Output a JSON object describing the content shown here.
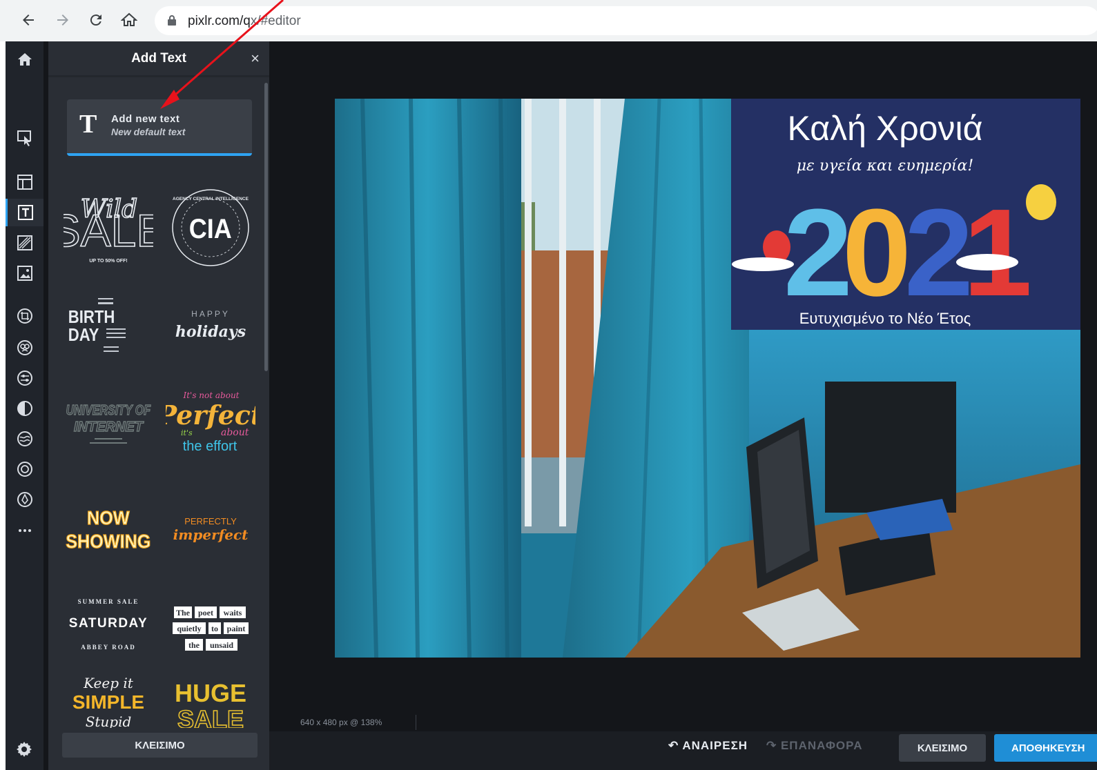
{
  "browser": {
    "url_host": "pixlr.com/",
    "url_path": "x/#editor"
  },
  "panel": {
    "title": "Add Text",
    "close_glyph": "×",
    "add_new_text": "Add new text",
    "add_new_subtext": "New default text",
    "t_glyph": "T",
    "footer_close": "ΚΛΕΙΣΙΜΟ"
  },
  "presets": [
    {
      "name": "wild-sale",
      "lines": [
        "Wild",
        "SALE",
        "UP TO 50% OFF!"
      ]
    },
    {
      "name": "cia",
      "lines": [
        "CIA",
        "AGENCY CENTRAL INTELLIGENCE"
      ]
    },
    {
      "name": "birthday",
      "lines": [
        "BIRTH",
        "DAY"
      ]
    },
    {
      "name": "happy-holidays",
      "lines": [
        "HAPPY",
        "holidays"
      ]
    },
    {
      "name": "university-of-internet",
      "lines": [
        "UNIVERSITY OF",
        "INTERNET"
      ]
    },
    {
      "name": "perfect-effort",
      "lines": [
        "It's not about",
        "Perfect",
        "it's",
        "about",
        "the effort"
      ]
    },
    {
      "name": "now-showing",
      "lines": [
        "NOW",
        "SHOWING"
      ]
    },
    {
      "name": "perfectly-imperfect",
      "lines": [
        "PERFECTLY",
        "imperfect"
      ]
    },
    {
      "name": "saturday",
      "lines": [
        "SUMMER SALE",
        "SATURDAY",
        "ABBEY ROAD"
      ]
    },
    {
      "name": "poet-waits",
      "lines": [
        "The",
        "poet",
        "waits",
        "quietly",
        "to",
        "paint",
        "the",
        "unsaid"
      ]
    },
    {
      "name": "keep-it-simple",
      "lines": [
        "Keep it",
        "SIMPLE",
        "Stupid"
      ]
    },
    {
      "name": "huge-sale",
      "lines": [
        "HUGE",
        "SALE"
      ]
    }
  ],
  "canvas": {
    "info": "640 x 480 px @ 138%",
    "greeting_title": "Καλή Χρονιά",
    "greeting_subtitle": "με υγεία και ευημερία!",
    "greeting_year": "2021",
    "greeting_footer": "Ευτυχισμένο το Νέο Έτος"
  },
  "bottom": {
    "undo": "ΑΝΑΙΡΕΣΗ",
    "redo": "ΕΠΑΝΑΦΟΡΑ",
    "close": "ΚΛΕΙΣΙΜΟ",
    "save": "ΑΠΟΘΗΚΕΥΣΗ"
  },
  "colors": {
    "accent": "#2ea3f2",
    "save": "#1f8ed6",
    "annotation_arrow": "#e8121b"
  }
}
